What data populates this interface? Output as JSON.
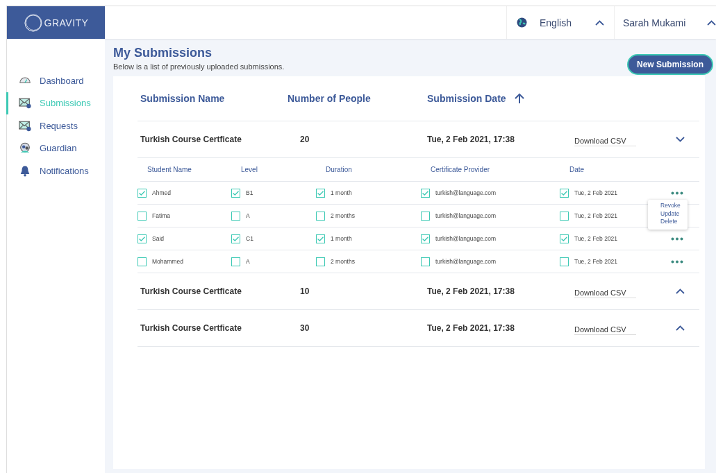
{
  "logo": {
    "text": "GRAVITY"
  },
  "header": {
    "language": "English",
    "user": "Sarah Mukami"
  },
  "sidebar": {
    "items": [
      {
        "label": "Dashboard",
        "selected": false
      },
      {
        "label": "Submissions",
        "selected": true
      },
      {
        "label": "Requests",
        "selected": false
      },
      {
        "label": "Guardian",
        "selected": false
      },
      {
        "label": "Notifications",
        "selected": false
      }
    ]
  },
  "page": {
    "title": "My Submissions",
    "subtitle": "Below is a list of previously uploaded submissions.",
    "new_button": "New Submission"
  },
  "table": {
    "columns": [
      "Submission Name",
      "Number of People",
      "Submission Date"
    ],
    "submissions": [
      {
        "name": "Turkish Course Certficate",
        "people": "20",
        "date": "Tue, 2 Feb 2021, 17:38",
        "download": "Download CSV",
        "expanded": true,
        "student_columns": [
          "Student Name",
          "Level",
          "Duration",
          "Certificate Provider",
          "Date"
        ],
        "menu_items": [
          "Revoke",
          "Update",
          "Delete"
        ],
        "students": [
          {
            "menu_open": false,
            "cells": [
              {
                "text": "Ahmed",
                "checked": true
              },
              {
                "text": "B1",
                "checked": true
              },
              {
                "text": "1 month",
                "checked": true
              },
              {
                "text": "turkish@language.com",
                "checked": true
              },
              {
                "text": "Tue, 2 Feb 2021",
                "checked": true
              }
            ]
          },
          {
            "menu_open": true,
            "cells": [
              {
                "text": "Fatima",
                "checked": false
              },
              {
                "text": "A",
                "checked": false
              },
              {
                "text": "2 months",
                "checked": false
              },
              {
                "text": "turkish@language.com",
                "checked": false
              },
              {
                "text": "Tue, 2 Feb 2021",
                "checked": false
              }
            ]
          },
          {
            "menu_open": false,
            "cells": [
              {
                "text": "Said",
                "checked": true
              },
              {
                "text": "C1",
                "checked": true
              },
              {
                "text": "1 month",
                "checked": true
              },
              {
                "text": "turkish@language.com",
                "checked": true
              },
              {
                "text": "Tue, 2 Feb 2021",
                "checked": true
              }
            ]
          },
          {
            "menu_open": false,
            "cells": [
              {
                "text": "Mohammed",
                "checked": false
              },
              {
                "text": "A",
                "checked": false
              },
              {
                "text": "2 months",
                "checked": false
              },
              {
                "text": "turkish@language.com",
                "checked": false
              },
              {
                "text": "Tue, 2 Feb 2021",
                "checked": false
              }
            ]
          }
        ]
      },
      {
        "name": "Turkish Course Certficate",
        "people": "10",
        "date": "Tue, 2 Feb 2021, 17:38",
        "download": "Download CSV",
        "expanded": false
      },
      {
        "name": "Turkish Course Certficate",
        "people": "30",
        "date": "Tue, 2 Feb 2021, 17:38",
        "download": "Download CSV",
        "expanded": false
      }
    ]
  }
}
